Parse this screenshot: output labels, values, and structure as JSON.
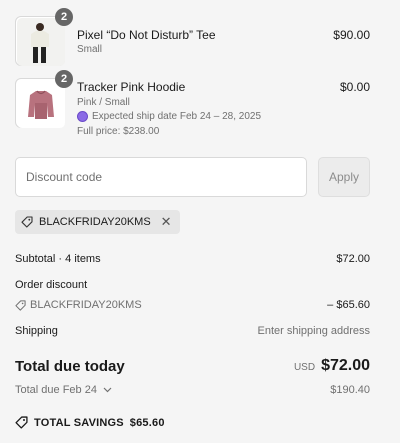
{
  "items": [
    {
      "quantity": "2",
      "name": "Pixel “Do Not Disturb” Tee",
      "variant": "Small",
      "price": "$90.00",
      "image_icon": "tshirt-model-image"
    },
    {
      "quantity": "2",
      "name": "Tracker Pink Hoodie",
      "variant": "Pink / Small",
      "price": "$0.00",
      "ship_note": "Expected ship date Feb 24 – 28, 2025",
      "full_price": "Full price: $238.00",
      "image_icon": "pink-hoodie-image",
      "ship_dot_color": "#8a6ae6"
    }
  ],
  "discount": {
    "placeholder": "Discount code",
    "apply_label": "Apply",
    "applied_code": "BLACKFRIDAY20KMS"
  },
  "summary": {
    "subtotal_label": "Subtotal · 4 items",
    "subtotal_value": "$72.00",
    "order_discount_label": "Order discount",
    "order_discount_code": "BLACKFRIDAY20KMS",
    "order_discount_value": "– $65.60",
    "shipping_label": "Shipping",
    "shipping_value": "Enter shipping address",
    "total_label": "Total due today",
    "total_currency": "USD",
    "total_value": "$72.00",
    "due_later_label": "Total due Feb 24",
    "due_later_value": "$190.40",
    "savings_label": "TOTAL SAVINGS",
    "savings_value": "$65.60"
  }
}
